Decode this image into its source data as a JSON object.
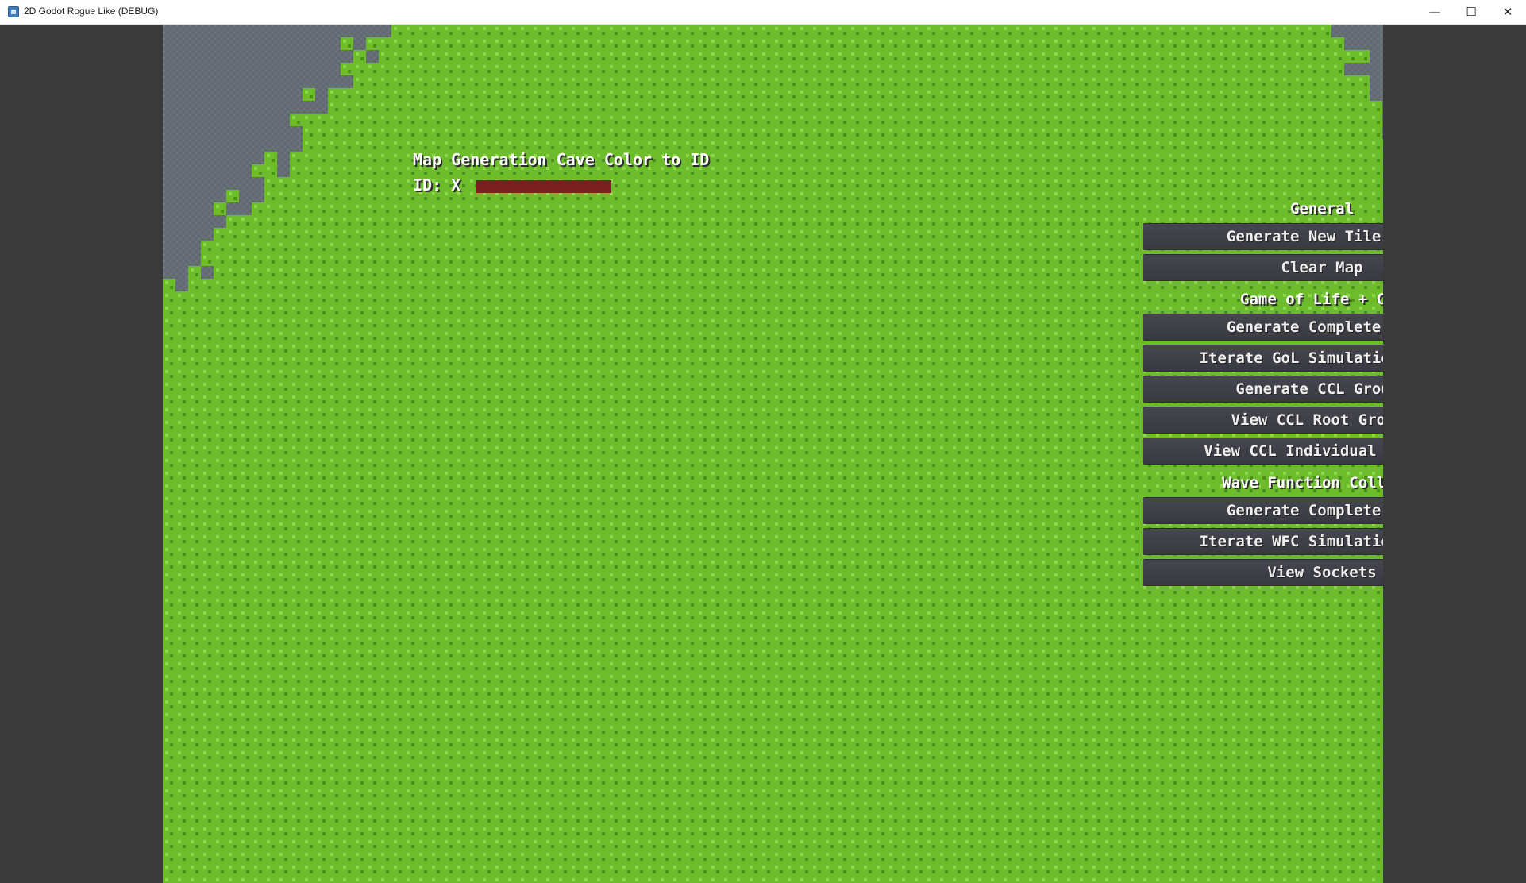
{
  "window": {
    "title": "2D Godot Rogue Like (DEBUG)",
    "minimize_glyph": "—",
    "maximize_glyph": "☐",
    "close_glyph": "✕"
  },
  "map": {
    "floor_color": "#6a7178",
    "wall_color": "#6cbc2c",
    "wall_highlight_color": "#8fd64a",
    "wall_shadow_color": "#4f8f1e"
  },
  "overlay": {
    "title": "Map Generation Cave Color to ID",
    "id_label": "ID: X",
    "swatch_color": "#7a1f1f"
  },
  "panel": {
    "sections": [
      {
        "label": "General",
        "buttons": [
          "Generate New Tile Map",
          "Clear Map"
        ]
      },
      {
        "label": "Game of Life + CCL",
        "buttons": [
          "Generate Complete Map",
          "Iterate GoL Simulation Once",
          "Generate CCL Groups",
          "View CCL Root Groups",
          "View CCL Individual Groups"
        ]
      },
      {
        "label": "Wave Function Collapse",
        "buttons": [
          "Generate Complete Map",
          "Iterate WFC Simulation Once",
          "View Sockets"
        ]
      }
    ]
  }
}
